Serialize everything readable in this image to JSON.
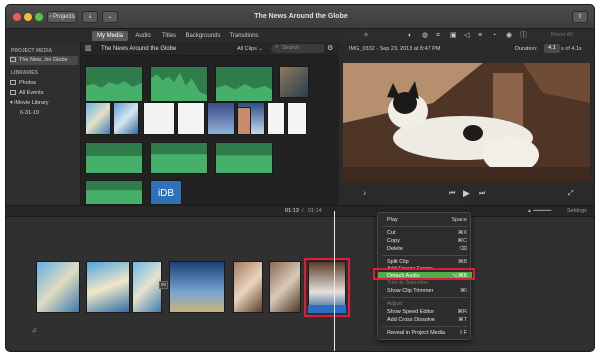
{
  "window": {
    "title": "The News Around the Globe"
  },
  "toolbar": {
    "projects_label": "Projects"
  },
  "tabs": [
    {
      "label": "My Media",
      "active": true
    },
    {
      "label": "Audio",
      "active": false
    },
    {
      "label": "Titles",
      "active": false
    },
    {
      "label": "Backgrounds",
      "active": false
    },
    {
      "label": "Transitions",
      "active": false
    }
  ],
  "sidebar": {
    "project_header": "PROJECT MEDIA",
    "project_item": "The New...he Globe",
    "libraries_header": "LIBRARIES",
    "items": [
      "Photos",
      "All Events",
      "iMovie Library",
      "6-31-19"
    ]
  },
  "browser": {
    "title": "The News Around the Globe",
    "filter": "All Clips",
    "search_placeholder": "Search"
  },
  "viewer": {
    "clip_info": "IMG_0332 - Sep 23, 2013 at 8:47 PM",
    "duration_label": "Duration:",
    "duration_value": "4.1",
    "duration_total": "s of 4.1s",
    "reset_all": "Reset All"
  },
  "timeline": {
    "time_current": "01:13",
    "time_sep": "/",
    "time_total": "01:14",
    "settings": "Settings"
  },
  "context_menu": [
    {
      "label": "Play",
      "shortcut": "Space"
    },
    {
      "label": "Cut",
      "shortcut": "⌘X"
    },
    {
      "label": "Copy",
      "shortcut": "⌘C"
    },
    {
      "label": "Delete",
      "shortcut": "⌫"
    },
    {
      "label": "Split Clip",
      "shortcut": "⌘B"
    },
    {
      "label": "Add Freeze Frame",
      "shortcut": ""
    },
    {
      "label": "Detach Audio",
      "shortcut": "⌥⌘B"
    },
    {
      "label": "Trim to Selection",
      "shortcut": ""
    },
    {
      "label": "Show Clip Trimmer",
      "shortcut": "⌘\\"
    },
    {
      "label": "Adjust",
      "shortcut": ""
    },
    {
      "label": "Show Speed Editor",
      "shortcut": "⌘R"
    },
    {
      "label": "Add Cross Dissolve",
      "shortcut": "⌘T"
    },
    {
      "label": "Reveal in Project Media",
      "shortcut": "⇧F"
    }
  ],
  "media_thumb_text": "iDB",
  "colors": {
    "audio_green": "#2f7d4b",
    "highlight": "#4fae4a",
    "annotation_red": "#e01b3a"
  }
}
